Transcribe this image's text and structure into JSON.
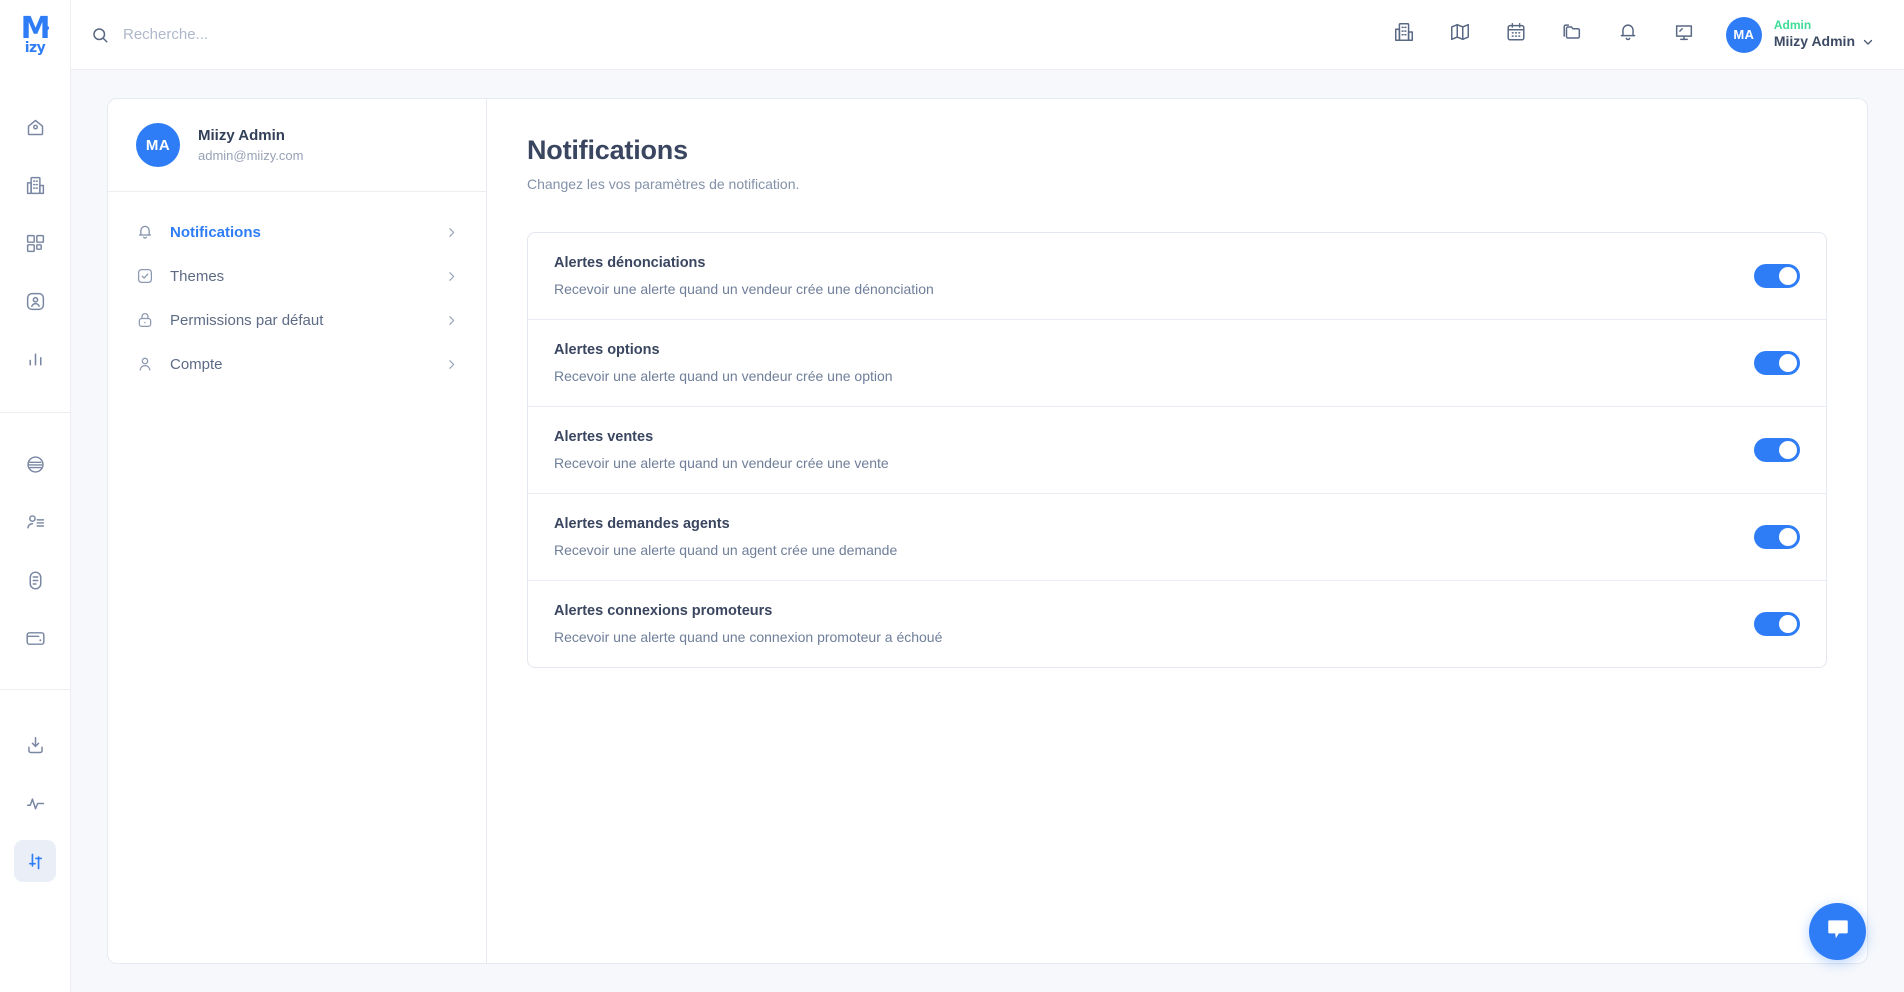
{
  "brand": {
    "logo_main": "M",
    "logo_sub": "izy",
    "accent": "#2f7df6",
    "green": "#3ddc97"
  },
  "rail": {
    "top_items": [
      {
        "name": "home-icon",
        "label": "Accueil"
      },
      {
        "name": "building-icon",
        "label": "Immeubles"
      },
      {
        "name": "grid-icon",
        "label": "Modules"
      },
      {
        "name": "user-square-icon",
        "label": "Contacts"
      },
      {
        "name": "bar-chart-icon",
        "label": "Statistiques"
      }
    ],
    "mid_items": [
      {
        "name": "circle-lines-icon",
        "label": "Flux"
      },
      {
        "name": "user-list-icon",
        "label": "Agents"
      },
      {
        "name": "document-icon",
        "label": "Documents"
      },
      {
        "name": "wallet-icon",
        "label": "Paiements"
      }
    ],
    "bottom_items": [
      {
        "name": "download-icon",
        "label": "Exports"
      },
      {
        "name": "activity-icon",
        "label": "Activité"
      },
      {
        "name": "sliders-icon",
        "label": "Paramètres",
        "active": true
      }
    ]
  },
  "search": {
    "placeholder": "Recherche...",
    "value": ""
  },
  "topbar": {
    "icons": [
      {
        "name": "building-icon"
      },
      {
        "name": "map-icon"
      },
      {
        "name": "calendar-icon"
      },
      {
        "name": "folders-icon"
      },
      {
        "name": "bell-icon"
      },
      {
        "name": "monitor-icon"
      }
    ],
    "user": {
      "initials": "MA",
      "role": "Admin",
      "name": "Miizy Admin"
    }
  },
  "sidecard": {
    "user": {
      "initials": "MA",
      "name": "Miizy Admin",
      "email": "admin@miizy.com"
    },
    "menu": [
      {
        "label": "Notifications",
        "icon": "bell-icon",
        "active": true
      },
      {
        "label": "Themes",
        "icon": "check-square-icon",
        "active": false
      },
      {
        "label": "Permissions par défaut",
        "icon": "lock-icon",
        "active": false
      },
      {
        "label": "Compte",
        "icon": "user-icon",
        "active": false
      }
    ]
  },
  "panel": {
    "title": "Notifications",
    "subtitle": "Changez les vos paramètres de notification.",
    "rows": [
      {
        "title": "Alertes dénonciations",
        "desc": "Recevoir une alerte quand un vendeur crée une dénonciation",
        "enabled": true
      },
      {
        "title": "Alertes options",
        "desc": "Recevoir une alerte quand un vendeur crée une option",
        "enabled": true
      },
      {
        "title": "Alertes ventes",
        "desc": "Recevoir une alerte quand un vendeur crée une vente",
        "enabled": true
      },
      {
        "title": "Alertes demandes agents",
        "desc": "Recevoir une alerte quand un agent crée une demande",
        "enabled": true
      },
      {
        "title": "Alertes connexions promoteurs",
        "desc": "Recevoir une alerte quand une connexion promoteur a échoué",
        "enabled": true
      }
    ]
  },
  "chat": {
    "name": "chat-bubble-button"
  }
}
